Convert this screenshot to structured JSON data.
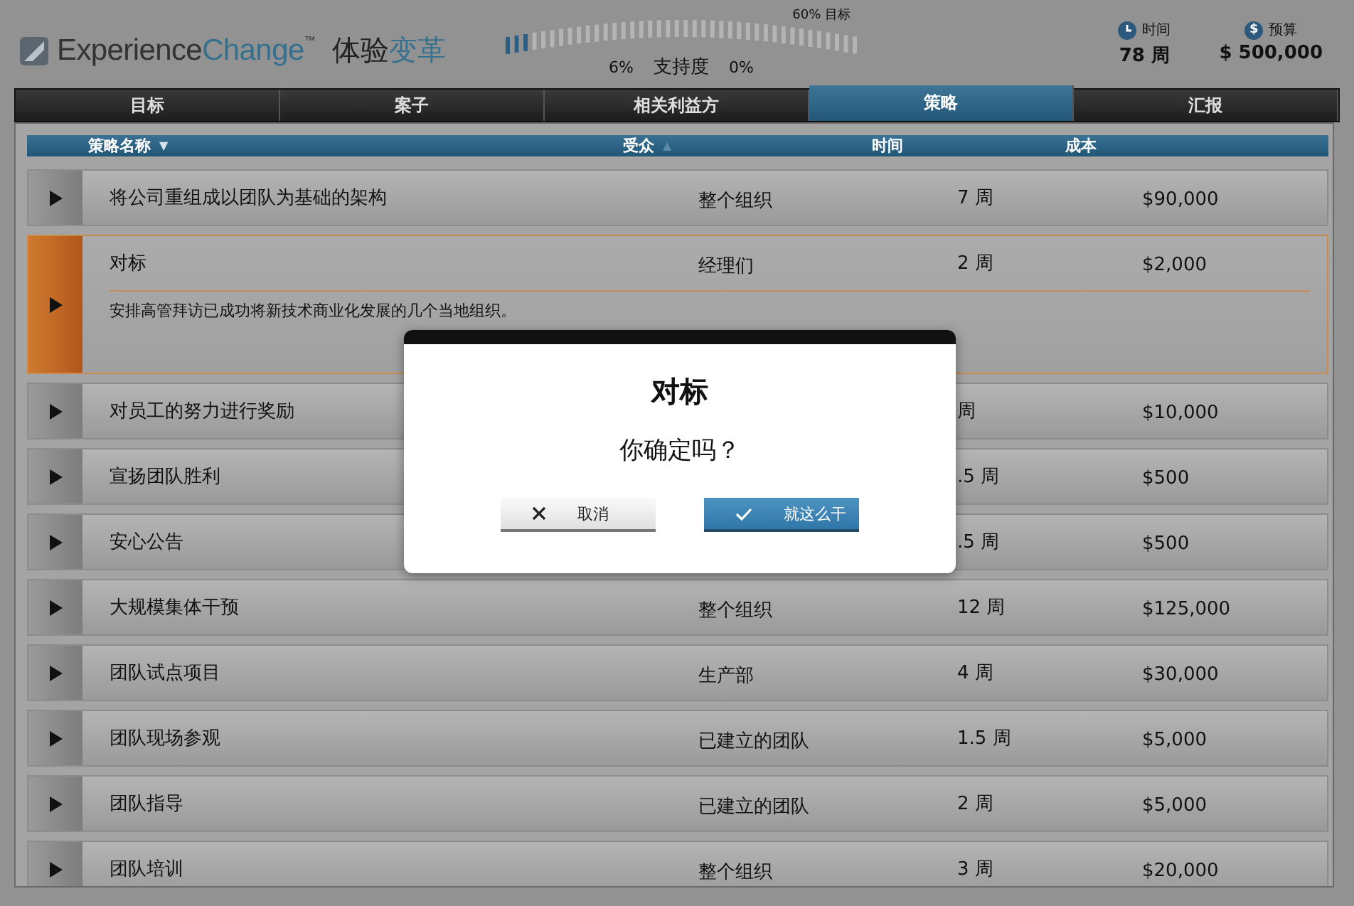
{
  "logo": {
    "parts": [
      {
        "text": "Experience",
        "accent": false
      },
      {
        "text": "Change",
        "accent": true
      }
    ],
    "tm": "™",
    "cn_parts": [
      {
        "text": "体验",
        "accent": false
      },
      {
        "text": "变革",
        "accent": true
      }
    ]
  },
  "support": {
    "level": 0.06,
    "target_label": "60% 目标",
    "current": "6%",
    "label": "支持度",
    "change": "0%"
  },
  "stats": [
    {
      "kind": "time",
      "label": "时间",
      "value": "78 周"
    },
    {
      "kind": "budget",
      "glyph": "$",
      "label": "预算",
      "value": "$ 500,000"
    }
  ],
  "tabs": [
    {
      "label": "目标",
      "selected": false
    },
    {
      "label": "案子",
      "selected": false
    },
    {
      "label": "相关利益方",
      "selected": false
    },
    {
      "label": "策略",
      "selected": true
    },
    {
      "label": "汇报",
      "selected": false
    }
  ],
  "table": {
    "columns": [
      {
        "label": "策略名称",
        "sort_glyph": "▼",
        "sort_active": true
      },
      {
        "label": "受众",
        "sort_glyph": "▲",
        "sort_active": false
      },
      {
        "label": "时间"
      },
      {
        "label": "成本"
      }
    ],
    "rows": [
      {
        "name": "将公司重组成以团队为基础的架构",
        "audience": "整个组织",
        "time": "7 周",
        "cost": "$90,000",
        "expanded": false,
        "selected": false
      },
      {
        "name": "对标",
        "audience": "经理们",
        "time": "2 周",
        "cost": "$2,000",
        "expanded": true,
        "selected": true,
        "description": "安排高管拜访已成功将新技术商业化发展的几个当地组织。"
      },
      {
        "name": "对员工的努力进行奖励",
        "time": "周",
        "cost": "$10,000",
        "expanded": false,
        "selected": false
      },
      {
        "name": "宣扬团队胜利",
        "time": ".5 周",
        "cost": "$500",
        "expanded": false,
        "selected": false
      },
      {
        "name": "安心公告",
        "time": ".5 周",
        "cost": "$500",
        "expanded": false,
        "selected": false
      },
      {
        "name": "大规模集体干预",
        "audience": "整个组织",
        "time": "12 周",
        "cost": "$125,000",
        "expanded": false,
        "selected": false
      },
      {
        "name": "团队试点项目",
        "audience": "生产部",
        "time": "4 周",
        "cost": "$30,000",
        "expanded": false,
        "selected": false
      },
      {
        "name": "团队现场参观",
        "audience": "已建立的团队",
        "time": "1.5 周",
        "cost": "$5,000",
        "expanded": false,
        "selected": false
      },
      {
        "name": "团队指导",
        "audience": "已建立的团队",
        "time": "2 周",
        "cost": "$5,000",
        "expanded": false,
        "selected": false
      },
      {
        "name": "团队培训",
        "audience": "整个组织",
        "time": "3 周",
        "cost": "$20,000",
        "expanded": false,
        "selected": false
      }
    ]
  },
  "dialog": {
    "title": "对标",
    "message": "你确定吗？",
    "buttons": [
      {
        "kind": "cancel",
        "label": "取消"
      },
      {
        "kind": "confirm",
        "label": "就这么干"
      }
    ]
  }
}
